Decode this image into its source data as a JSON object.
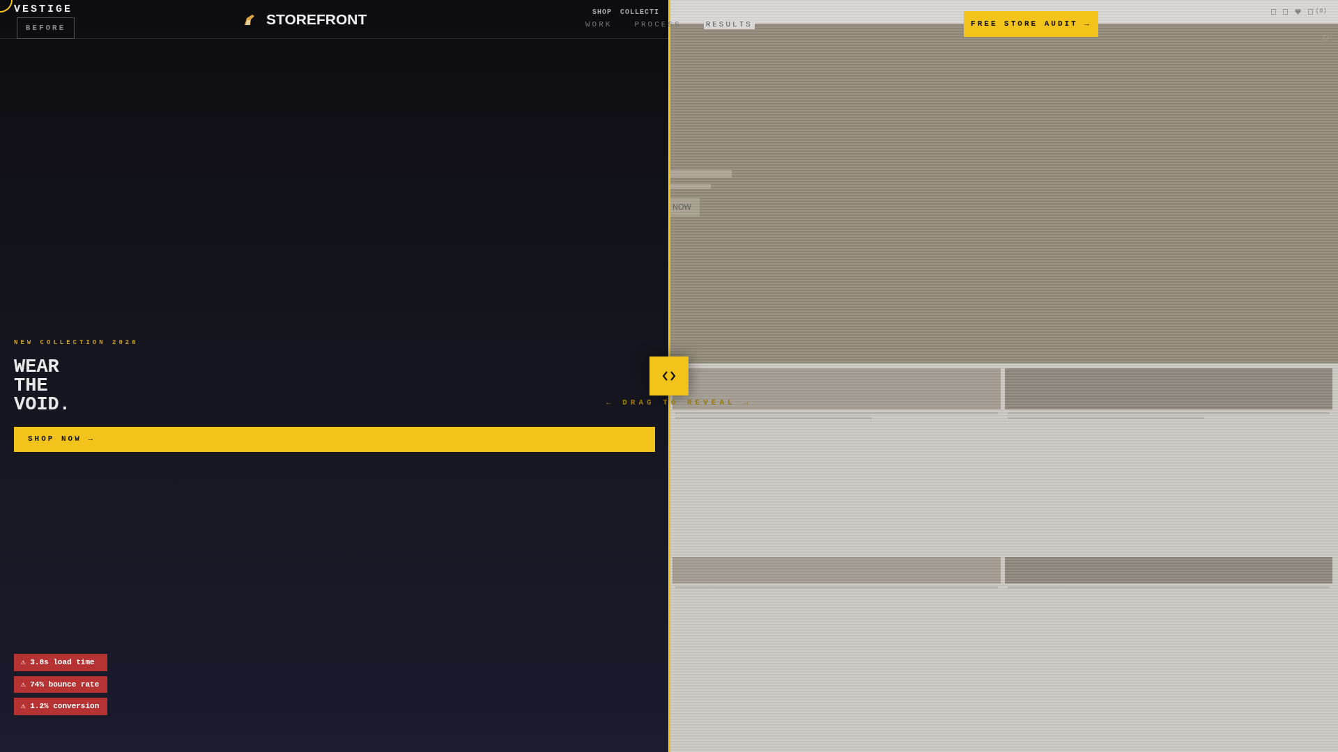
{
  "agency_header": {
    "logo": "VESTIGE",
    "nav": [
      {
        "label": "WORK"
      },
      {
        "label": "PROCESS"
      },
      {
        "label": "RESULTS"
      }
    ],
    "cta": "FREE STORE AUDIT →"
  },
  "before_label": "BEFORE",
  "before_store": {
    "brand": "STOREFRONT",
    "nav": [
      "SHOP",
      "COLLECTI"
    ],
    "eyebrow": "NEW COLLECTION 2026",
    "headline": [
      "WEAR",
      "THE",
      "VOID."
    ],
    "cta": "SHOP NOW →",
    "issues": [
      "⚠ 3.8s load time",
      "⚠ 74% bounce rate",
      "⚠ 1.2% conversion"
    ]
  },
  "slider": {
    "hint": "← DRAG TO REVEAL →"
  },
  "after_store": {
    "cart_count": "(0)",
    "hero_button": "NOW"
  }
}
